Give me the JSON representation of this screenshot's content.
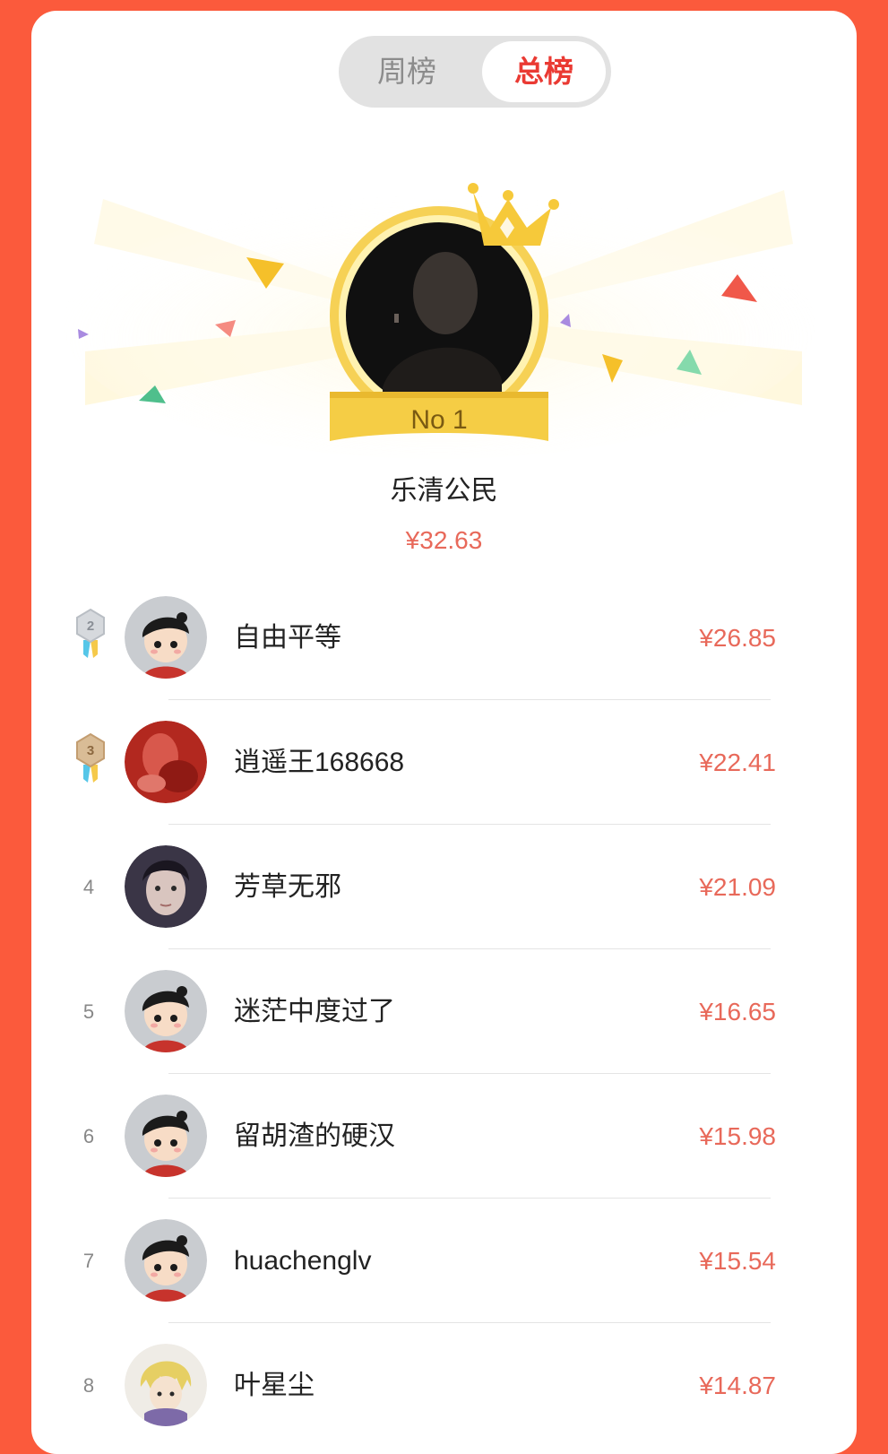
{
  "tabs": {
    "week_label": "周榜",
    "total_label": "总榜",
    "active": "total"
  },
  "top": {
    "badge": "No 1",
    "name": "乐清公民",
    "amount": "¥32.63"
  },
  "ranking": [
    {
      "rank": "2",
      "name": "自由平等",
      "amount": "¥26.85",
      "avatar": "default-avatar",
      "medal": "silver-medal-icon"
    },
    {
      "rank": "3",
      "name": "逍遥王168668",
      "amount": "¥22.41",
      "avatar": "red-photo-avatar",
      "medal": "bronze-medal-icon"
    },
    {
      "rank": "4",
      "name": "芳草无邪",
      "amount": "¥21.09",
      "avatar": "woman-photo-avatar"
    },
    {
      "rank": "5",
      "name": "迷茫中度过了",
      "amount": "¥16.65",
      "avatar": "default-avatar"
    },
    {
      "rank": "6",
      "name": "留胡渣的硬汉",
      "amount": "¥15.98",
      "avatar": "default-avatar"
    },
    {
      "rank": "7",
      "name": "huachenglv",
      "amount": "¥15.54",
      "avatar": "default-avatar"
    },
    {
      "rank": "8",
      "name": "叶星尘",
      "amount": "¥14.87",
      "avatar": "anime-avatar"
    }
  ],
  "colors": {
    "background": "#fb5a3c",
    "accent": "#ea3a33",
    "amount": "#e8695a",
    "gold": "#f5cd45"
  }
}
